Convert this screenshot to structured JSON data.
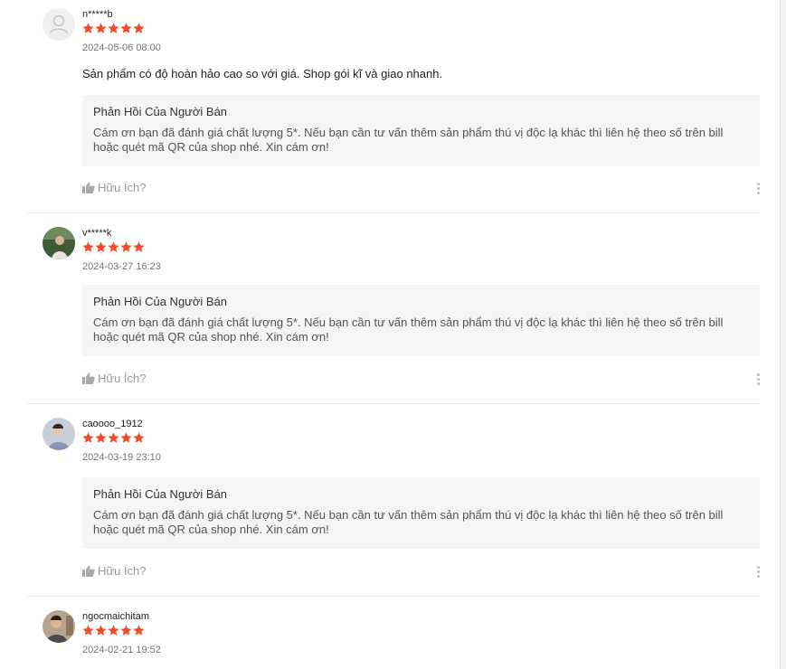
{
  "reviews": [
    {
      "username": "n*****b",
      "rating": 5,
      "date": "2024-05-06 08:00",
      "comment": "Sản phẩm có độ hoàn hảo cao so với giá. Shop gói kĩ và giao nhanh.",
      "avatar": "default-user-icon",
      "reply": {
        "title": "Phản Hồi Của Người Bán",
        "text": "Cám ơn bạn đã đánh giá chất lượng 5*. Nếu bạn cần tư vấn thêm sản phẩm thú vị độc lạ khác thì liên hệ theo số trên bill hoặc quét mã QR của shop nhé. Xin cám ơn!"
      },
      "helpful_label": "Hữu Ích?"
    },
    {
      "username": "v*****k",
      "rating": 5,
      "date": "2024-03-27 16:23",
      "avatar": "photo-avatar",
      "reply": {
        "title": "Phản Hồi Của Người Bán",
        "text": "Cám ơn bạn đã đánh giá chất lượng 5*. Nếu bạn cần tư vấn thêm sản phẩm thú vị độc lạ khác thì liên hệ theo số trên bill hoặc quét mã QR của shop nhé. Xin cám ơn!"
      },
      "helpful_label": "Hữu Ích?"
    },
    {
      "username": "caoooo_1912",
      "rating": 5,
      "date": "2024-03-19 23:10",
      "avatar": "photo-avatar",
      "reply": {
        "title": "Phản Hồi Của Người Bán",
        "text": "Cám ơn bạn đã đánh giá chất lượng 5*. Nếu bạn cần tư vấn thêm sản phẩm thú vị độc lạ khác thì liên hệ theo số trên bill hoặc quét mã QR của shop nhé. Xin cám ơn!"
      },
      "helpful_label": "Hữu Ích?"
    },
    {
      "username": "ngocmaichitam",
      "rating": 5,
      "date": "2024-02-21 19:52",
      "avatar": "photo-avatar"
    }
  ],
  "colors": {
    "star": "#ee4d2d",
    "reply_bg": "#f5f5f5",
    "muted": "#9a9a9a"
  }
}
